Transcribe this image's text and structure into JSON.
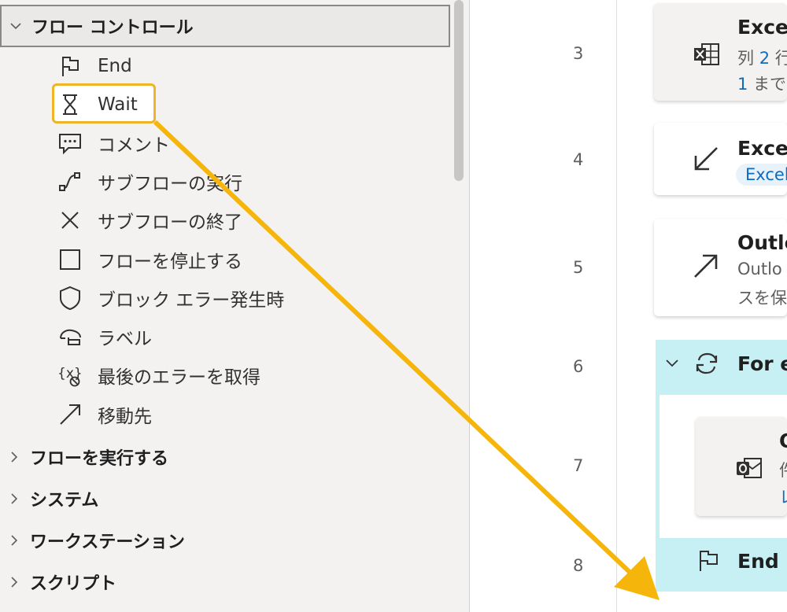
{
  "actions_pane": {
    "groups": [
      {
        "label": "フロー コントロール",
        "expanded": true
      },
      {
        "label": "フローを実行する",
        "expanded": false
      },
      {
        "label": "システム",
        "expanded": false
      },
      {
        "label": "ワークステーション",
        "expanded": false
      },
      {
        "label": "スクリプト",
        "expanded": false
      }
    ],
    "flow_control_items": [
      {
        "label": "End",
        "icon": "flag-icon"
      },
      {
        "label": "Wait",
        "icon": "hourglass-icon"
      },
      {
        "label": "コメント",
        "icon": "comment-icon"
      },
      {
        "label": "サブフローの実行",
        "icon": "run-subflow-icon"
      },
      {
        "label": "サブフローの終了",
        "icon": "close-icon"
      },
      {
        "label": "フローを停止する",
        "icon": "stop-square-icon"
      },
      {
        "label": "ブロック エラー発生時",
        "icon": "shield-icon"
      },
      {
        "label": "ラベル",
        "icon": "label-icon"
      },
      {
        "label": "最後のエラーを取得",
        "icon": "variable-error-icon"
      },
      {
        "label": "移動先",
        "icon": "goto-arrow-icon"
      }
    ]
  },
  "flow": {
    "line_numbers": [
      "3",
      "4",
      "5",
      "6",
      "7",
      "8"
    ],
    "step3": {
      "title": "Excel",
      "desc1_a": "列 ",
      "desc1_b": "2",
      "desc1_c": " 行",
      "desc2_a": "1",
      "desc2_b": " までの"
    },
    "step4": {
      "title": "Excel",
      "pill": "Excel"
    },
    "step5": {
      "title": "Outlo",
      "desc1": "Outlo",
      "desc2": "スを保"
    },
    "step6": {
      "title": "For e"
    },
    "step7": {
      "title": "O",
      "desc1": "件",
      "desc2": "レ"
    },
    "step8": {
      "title": "End"
    }
  },
  "colors": {
    "highlight": "#f0b429",
    "arrow": "#f5b50a",
    "loop_background": "#c7f0f5",
    "link_blue": "#0f6cbd"
  }
}
